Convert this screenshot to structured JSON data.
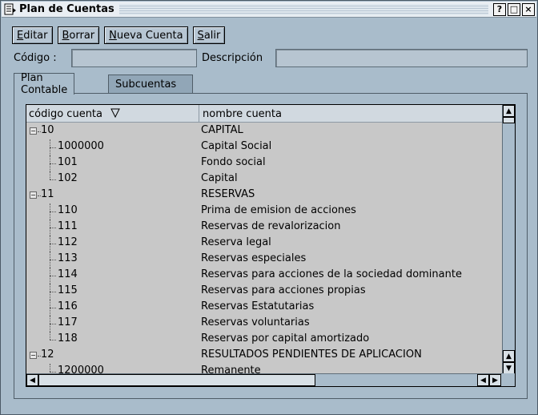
{
  "window": {
    "title": "Plan de Cuentas",
    "controls": [
      "?",
      "□",
      "×"
    ]
  },
  "toolbar": {
    "edit": "Editar",
    "delete": "Borrar",
    "new_account": "Nueva Cuenta",
    "exit": "Salir"
  },
  "form": {
    "code_label": "Código :",
    "code_value": "",
    "description_label": "Descripción",
    "description_value": ""
  },
  "tabs": [
    {
      "label": "Plan Contable",
      "active": true
    },
    {
      "label": "Subcuentas",
      "active": false
    }
  ],
  "table": {
    "columns": [
      "código cuenta",
      "nombre cuenta"
    ],
    "rows": [
      {
        "code": "10",
        "name": "CAPITAL",
        "level": 0,
        "expander": "−"
      },
      {
        "code": "1000000",
        "name": "Capital Social",
        "level": 1
      },
      {
        "code": "101",
        "name": "Fondo social",
        "level": 1
      },
      {
        "code": "102",
        "name": "Capital",
        "level": 1
      },
      {
        "code": "11",
        "name": "RESERVAS",
        "level": 0,
        "expander": "−"
      },
      {
        "code": "110",
        "name": "Prima de emision de acciones",
        "level": 1
      },
      {
        "code": "111",
        "name": "Reservas de revalorizacion",
        "level": 1
      },
      {
        "code": "112",
        "name": "Reserva legal",
        "level": 1
      },
      {
        "code": "113",
        "name": "Reservas especiales",
        "level": 1
      },
      {
        "code": "114",
        "name": "Reservas para acciones de la sociedad dominante",
        "level": 1
      },
      {
        "code": "115",
        "name": "Reservas para acciones propias",
        "level": 1
      },
      {
        "code": "116",
        "name": "Reservas Estatutarias",
        "level": 1
      },
      {
        "code": "117",
        "name": "Reservas voluntarias",
        "level": 1
      },
      {
        "code": "118",
        "name": "Reservas por capital amortizado",
        "level": 1
      },
      {
        "code": "12",
        "name": "RESULTADOS PENDIENTES DE APLICACION",
        "level": 0,
        "expander": "−"
      },
      {
        "code": "1200000",
        "name": "Remanente",
        "level": 1
      }
    ]
  },
  "colors": {
    "window_bg": "#a9bccb",
    "table_bg": "#c8c8c8",
    "titlebar_bg": "#e9eef3"
  }
}
